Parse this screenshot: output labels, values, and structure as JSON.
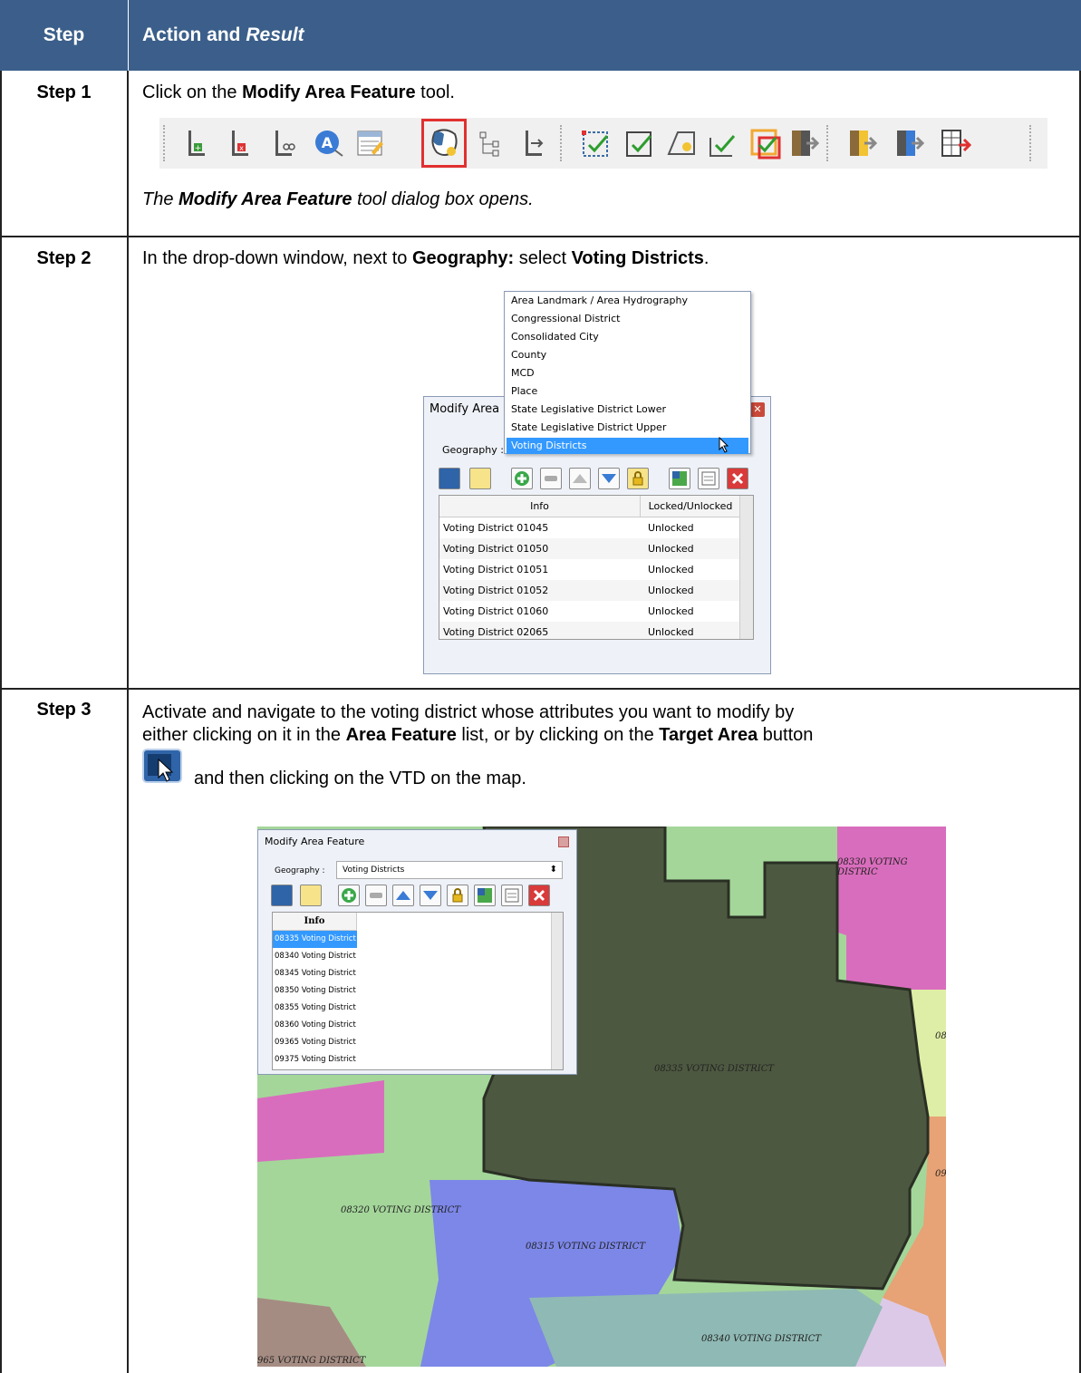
{
  "header": {
    "step": "Step",
    "action": "Action and",
    "result": "Result"
  },
  "steps": [
    {
      "label": "Step 1",
      "text_pre": "Click on the ",
      "text_bold": "Modify Area Feature",
      "text_post": " tool.",
      "result_pre": "The ",
      "result_bold": "Modify Area Feature",
      "result_post": " tool dialog box opens."
    },
    {
      "label": "Step 2",
      "text_pre": "In the drop-down window, next to ",
      "text_bold1": "Geography:",
      "text_mid": " select ",
      "text_bold2": "Voting Districts",
      "text_post": "."
    },
    {
      "label": "Step 3",
      "line1": "Activate and navigate to the voting district whose attributes you want to modify by",
      "line2_pre": "either clicking on it in the ",
      "line2_bold1": "Area Feature",
      "line2_mid": " list, or by clicking on the ",
      "line2_bold2": "Target Area",
      "line2_post": " button",
      "line3": "and then clicking on the VTD on the map."
    }
  ],
  "toolbar": {
    "icons": [
      "add-line-icon",
      "delete-line-icon",
      "split-line-icon",
      "label-icon",
      "attributes-icon",
      "modify-area-feature-icon",
      "merge-icon",
      "node-icon",
      "validate-icon",
      "validate-2-icon",
      "shape-icon",
      "check-icon",
      "review-icon",
      "import-icon",
      "export-icon",
      "export-2-icon",
      "table-export-icon"
    ],
    "selected": "modify-area-feature-icon"
  },
  "dialog2": {
    "title": "Modify Area F",
    "geography_label": "Geography :",
    "dropdown_options": [
      "Area Landmark / Area Hydrography",
      "Congressional District",
      "Consolidated City",
      "County",
      "MCD",
      "Place",
      "State Legislative District Lower",
      "State Legislative District Upper",
      "Voting Districts"
    ],
    "dropdown_selected": "Voting Districts",
    "grid_headers": [
      "Info",
      "Locked/Unlocked"
    ],
    "grid_rows": [
      {
        "info": "Voting District 01045",
        "status": "Unlocked"
      },
      {
        "info": "Voting District 01050",
        "status": "Unlocked"
      },
      {
        "info": "Voting District 01051",
        "status": "Unlocked"
      },
      {
        "info": "Voting District 01052",
        "status": "Unlocked"
      },
      {
        "info": "Voting District 01060",
        "status": "Unlocked"
      },
      {
        "info": "Voting District 02065",
        "status": "Unlocked"
      }
    ]
  },
  "dialog3": {
    "title": "Modify Area Feature",
    "geography_label": "Geography :",
    "geography_value": "Voting Districts",
    "grid_header": "Info",
    "rows": [
      "08335 Voting District",
      "08340 Voting District",
      "08345 Voting District",
      "08350 Voting District",
      "08355 Voting District",
      "08360 Voting District",
      "09365 Voting District",
      "09375 Voting District"
    ],
    "selected_row": "08335 Voting District"
  },
  "map": {
    "labels": {
      "d08335": "08335 VOTING DISTRICT",
      "d08320": "08320 VOTING DISTRICT",
      "d08315": "08315 VOTING DISTRICT",
      "d08340": "08340 VOTING DISTRICT",
      "d08330": "08330 VOTING DISTRIC",
      "d09": "09",
      "d08": "08",
      "bottom_left": "965 VOTING DISTRICT"
    },
    "colors": {
      "selected_district": "#4d5840",
      "green": "#a4d69a",
      "magenta": "#d96dbd",
      "blue": "#7c87e8",
      "teal": "#8fb9b4",
      "orange": "#e7a275",
      "brown": "#a58c82",
      "yellow_green": "#dfeea6",
      "lavender": "#dcc9e7"
    }
  }
}
